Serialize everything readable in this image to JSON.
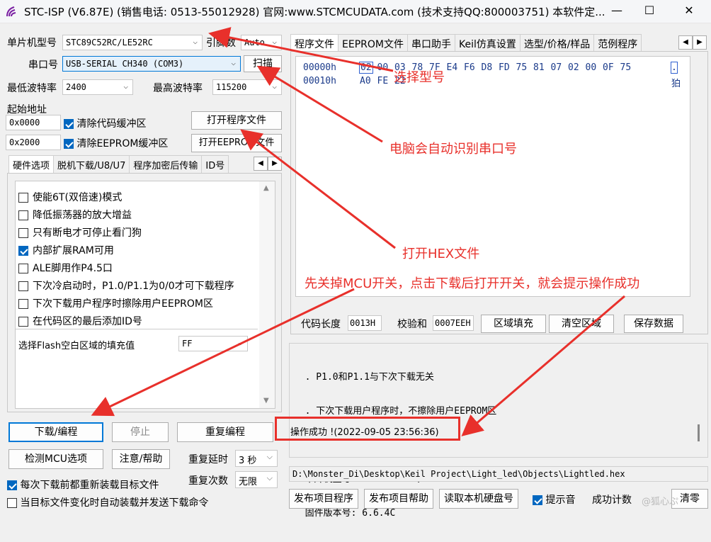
{
  "window": {
    "title": "STC-ISP (V6.87E) (销售电话: 0513-55012928) 官网:www.STCMCUDATA.com  (技术支持QQ:800003751) 本软件定...",
    "minimize": "—",
    "maximize": "☐",
    "close": "✕"
  },
  "left": {
    "mcu_label": "单片机型号",
    "mcu_value": "STC89C52RC/LE52RC",
    "pin_label": "引脚数",
    "pin_value": "Auto",
    "port_label": "串口号",
    "port_value": "USB-SERIAL CH340 (COM3)",
    "scan_button": "扫描",
    "min_baud_label": "最低波特率",
    "min_baud_value": "2400",
    "max_baud_label": "最高波特率",
    "max_baud_value": "115200",
    "start_addr_label": "起始地址",
    "addr1": "0x0000",
    "clear_code_label": "清除代码缓冲区",
    "open_prog_button": "打开程序文件",
    "addr2": "0x2000",
    "clear_eeprom_label": "清除EEPROM缓冲区",
    "open_eeprom_button": "打开EEPROM文件",
    "tabs": [
      "硬件选项",
      "脱机下载/U8/U7",
      "程序加密后传输",
      "ID号"
    ],
    "options": [
      {
        "label": "使能6T(双倍速)模式",
        "checked": false
      },
      {
        "label": "降低振荡器的放大增益",
        "checked": false
      },
      {
        "label": "只有断电才可停止看门狗",
        "checked": false
      },
      {
        "label": "内部扩展RAM可用",
        "checked": true
      },
      {
        "label": "ALE脚用作P4.5口",
        "checked": false
      },
      {
        "label": "下次冷启动时，P1.0/P1.1为0/0才可下载程序",
        "checked": false
      },
      {
        "label": "下次下载用户程序时擦除用户EEPROM区",
        "checked": false
      },
      {
        "label": "在代码区的最后添加ID号",
        "checked": false
      }
    ],
    "fill_label": "选择Flash空白区域的填充值",
    "fill_value": "FF",
    "download_button": "下载/编程",
    "stop_button": "停止",
    "repeat_button": "重复编程",
    "detect_button": "检测MCU选项",
    "help_button": "注意/帮助",
    "delay_label": "重复延时",
    "delay_value": "3 秒",
    "count_label": "重复次数",
    "count_value": "无限",
    "reload_label": "每次下载前都重新装载目标文件",
    "auto_send_label": "当目标文件变化时自动装载并发送下载命令"
  },
  "right": {
    "tabs": [
      "程序文件",
      "EEPROM文件",
      "串口助手",
      "Keil仿真设置",
      "选型/价格/样品",
      "范例程序"
    ],
    "hex_rows": [
      {
        "addr": "00000h",
        "bytes": [
          "02",
          "00",
          "03",
          "78",
          "7F",
          "E4",
          "F6",
          "D8",
          "FD",
          "75",
          "81",
          "07",
          "02",
          "00",
          "0F",
          "75"
        ],
        "ascii": "."
      },
      {
        "addr": "00010h",
        "bytes": [
          "A0",
          "FE",
          "22"
        ],
        "ascii": "狛"
      }
    ],
    "code_len_label": "代码长度",
    "code_len_value": "0013H",
    "checksum_label": "校验和",
    "checksum_value": "0007EEH",
    "fill_button": "区域填充",
    "clear_button": "清空区域",
    "save_button": "保存数据",
    "log_lines": [
      "  . P1.0和P1.1与下次下载无关",
      "  . 下次下载用户程序时，不擦除用户EEPROM区",
      "",
      "  单片机型号: STC89C52RC/LE52RC",
      "  固件版本号: 6.6.4C"
    ],
    "status_text": "操作成功 !(2022-09-05 23:56:36)",
    "file_path": "D:\\Monster_Di\\Desktop\\Keil Project\\Light_led\\Objects\\Lightled.hex",
    "publish_prog_button": "发布项目程序",
    "publish_help_button": "发布项目帮助",
    "read_disk_button": "读取本机硬盘号",
    "sound_label": "提示音",
    "success_count_label": "成功计数",
    "clear_count_button": "清零"
  },
  "annotations": {
    "select_model": "选择型号",
    "auto_port": "电脑会自动识别串口号",
    "open_hex": "打开HEX文件",
    "instruction": "先关掉MCU开关，点击下载后打开开关，就会提示操作成功",
    "watermark": "@狐心ぷ"
  },
  "colors": {
    "annotation_red": "#e8302b",
    "accent_blue": "#0067c0"
  }
}
